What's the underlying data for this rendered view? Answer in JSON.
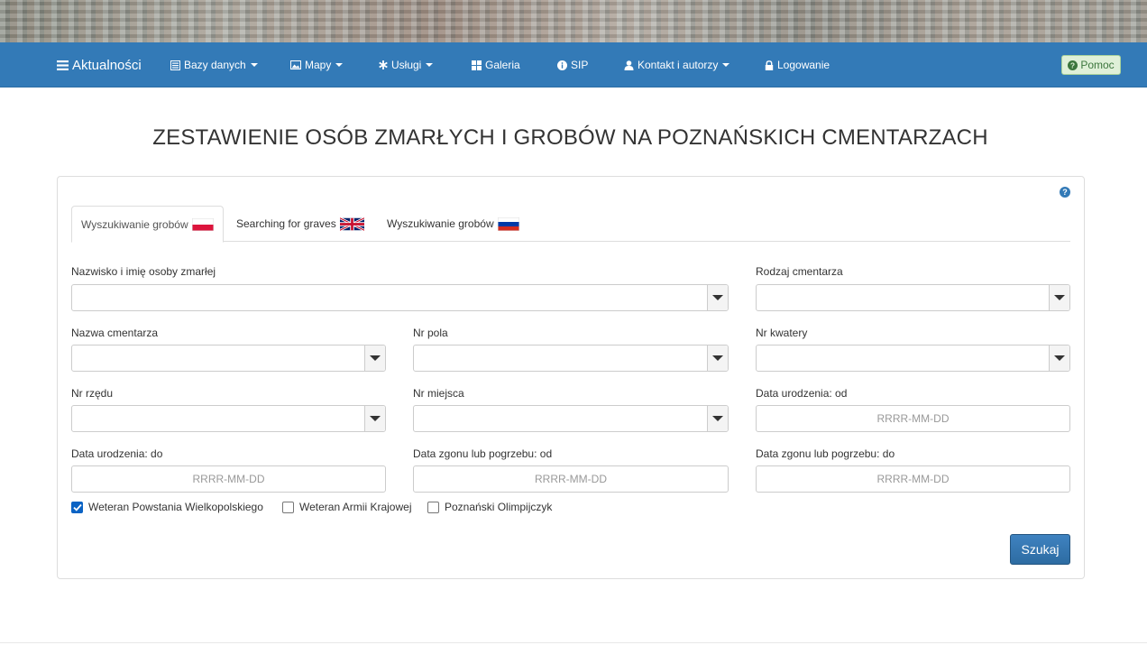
{
  "nav": {
    "brand": "Aktualności",
    "items": [
      {
        "label": "Bazy danych",
        "icon": "list-icon",
        "dropdown": true
      },
      {
        "label": "Mapy",
        "icon": "picture-icon",
        "dropdown": true
      },
      {
        "label": "Usługi",
        "icon": "asterisk-icon",
        "dropdown": true
      },
      {
        "label": "Galeria",
        "icon": "grid-icon",
        "dropdown": false
      },
      {
        "label": "SIP",
        "icon": "info-icon",
        "dropdown": false
      },
      {
        "label": "Kontakt i autorzy",
        "icon": "user-icon",
        "dropdown": true
      },
      {
        "label": "Logowanie",
        "icon": "lock-icon",
        "dropdown": false
      }
    ],
    "help": "Pomoc"
  },
  "title": "ZESTAWIENIE OSÓB ZMARŁYCH I GROBÓW NA POZNAŃSKICH CMENTARZACH",
  "tabs": [
    {
      "label": "Wyszukiwanie grobów",
      "flag": "poland-flag-icon",
      "active": true
    },
    {
      "label": "Searching for graves",
      "flag": "uk-flag-icon",
      "active": false
    },
    {
      "label": "Wyszukiwanie grobów",
      "flag": "russia-flag-icon",
      "active": false
    }
  ],
  "form": {
    "name_label": "Nazwisko i imię osoby zmarłej",
    "cemetery_type_label": "Rodzaj cmentarza",
    "cemetery_name_label": "Nazwa cmentarza",
    "field_label": "Nr pola",
    "quarter_label": "Nr kwatery",
    "row_label": "Nr rzędu",
    "place_label": "Nr miejsca",
    "birth_from_label": "Data urodzenia: od",
    "birth_to_label": "Data urodzenia: do",
    "death_from_label": "Data zgonu lub pogrzebu: od",
    "death_to_label": "Data zgonu lub pogrzebu: do",
    "date_placeholder": "RRRR-MM-DD"
  },
  "checkboxes": [
    {
      "label": "Weteran Powstania Wielkopolskiego",
      "checked": true
    },
    {
      "label": "Weteran Armii Krajowej",
      "checked": false
    },
    {
      "label": "Poznański Olimpijczyk",
      "checked": false
    }
  ],
  "search_button": "Szukaj",
  "colors": {
    "navbar": "#337ab7",
    "help_bg": "#dff0d8",
    "help_text": "#3c763d",
    "button": "#337ab7",
    "checkbox": "#0b63c4"
  }
}
